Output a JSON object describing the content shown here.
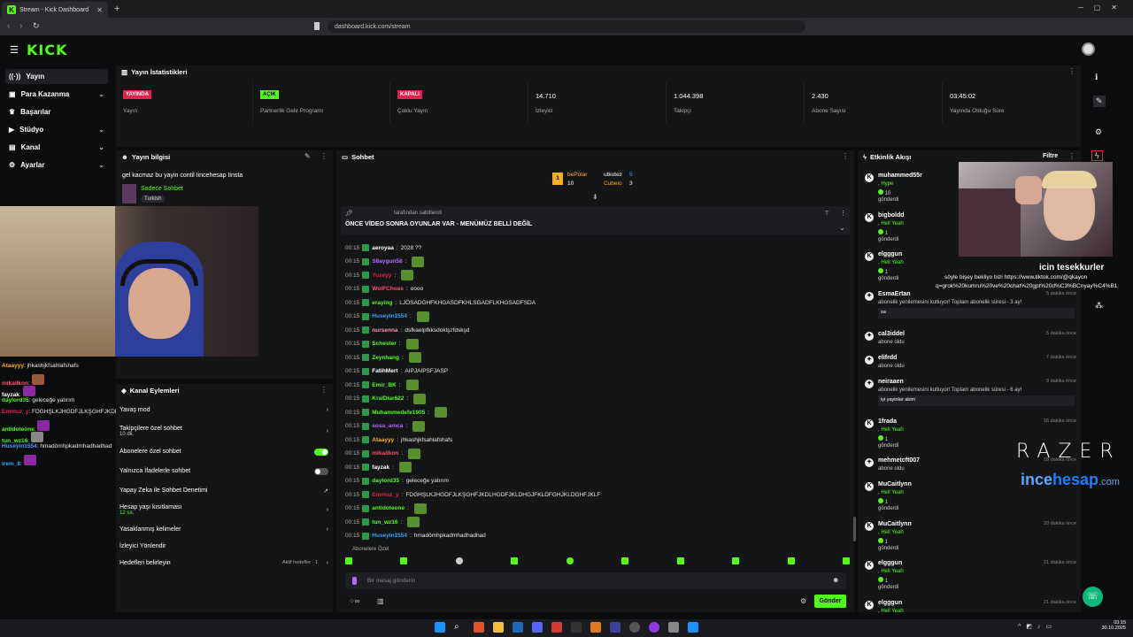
{
  "browser": {
    "tab_title": "Stream - Kick Dashboard",
    "new_tab": "+",
    "url": "dashboard.kick.com/stream"
  },
  "app": {
    "logo": "KICK"
  },
  "sidebar": {
    "items": [
      {
        "label": "Yayın",
        "icon": "broadcast-icon",
        "chevron": false,
        "active": true
      },
      {
        "label": "Para Kazanma",
        "icon": "money-icon",
        "chevron": true
      },
      {
        "label": "Başarılar",
        "icon": "trophy-icon",
        "chevron": false
      },
      {
        "label": "Stüdyo",
        "icon": "video-icon",
        "chevron": true
      },
      {
        "label": "Kanal",
        "icon": "channel-icon",
        "chevron": true
      },
      {
        "label": "Ayarlar",
        "icon": "gear-icon",
        "chevron": true
      }
    ]
  },
  "stats": {
    "title": "Yayın İstatistikleri",
    "items": [
      {
        "badge": "YAYINDA",
        "badge_color": "#e0224f",
        "label": "Yayın"
      },
      {
        "badge": "AÇIK",
        "badge_color": "#53fc18",
        "label": "Partnerlik Gelir Programı"
      },
      {
        "badge": "KAPALI",
        "badge_color": "#e0224f",
        "label": "Çoklu Yayın"
      },
      {
        "value": "14.710",
        "label": "İzleyici"
      },
      {
        "value": "1.044.398",
        "label": "Takipçi"
      },
      {
        "value": "2.430",
        "label": "Abone Sayısı"
      },
      {
        "value": "03:45:02",
        "label": "Yayında Olduğu Süre"
      }
    ]
  },
  "stream_info": {
    "title": "Yayın bilgisi",
    "stream_title": "gel kacmaz bu yayin contil Iincehesap Iinsta",
    "category": "Sadece Sohbet",
    "tag": "Turkish"
  },
  "chat": {
    "title": "Sohbet",
    "leaders": [
      {
        "rank": "1",
        "name": "bePolar",
        "count": "10"
      },
      {
        "name": "utkutez",
        "count": "5"
      },
      {
        "name": "Cubeio",
        "count": "3"
      }
    ],
    "pinned_by": "tarafından sabitlendi",
    "pinned_text": "ÖNCE VİDEO SONRA OYUNLAR VAR - MENÜMÜZ BELLİ DEĞİL",
    "messages": [
      {
        "time": "00:15",
        "user": "aeroyaa",
        "color": "#ffffff",
        "text": "2028 ??"
      },
      {
        "time": "00:15",
        "user": "S8aygun58",
        "color": "#b36bff",
        "text": "",
        "emote": true
      },
      {
        "time": "00:15",
        "user": "Yuzeyy",
        "color": "#e0224f",
        "text": "",
        "emote": true
      },
      {
        "time": "00:15",
        "user": "WolFChoas",
        "color": "#ff4d6d",
        "text": "oooo"
      },
      {
        "time": "00:15",
        "user": "eraying",
        "color": "#53fc18",
        "text": "LJÖSADGHFKHGASDFKHLSGADFLKHGSADFSDA"
      },
      {
        "time": "00:15",
        "user": "Huseyin1554",
        "color": "#3aa0ff",
        "text": "",
        "emote": true
      },
      {
        "time": "00:15",
        "user": "nursenna",
        "color": "#ff8fb1",
        "text": "dsfkaelpfkksdoklşzfdskşd"
      },
      {
        "time": "00:15",
        "user": "Schester",
        "color": "#53fc18",
        "text": "",
        "emote": true
      },
      {
        "time": "00:15",
        "user": "Zeynhang",
        "color": "#53fc18",
        "text": "",
        "emote": true
      },
      {
        "time": "00:15",
        "user": "FatihMert",
        "color": "#ffffff",
        "text": "AIPJAIPSFJASP"
      },
      {
        "time": "00:15",
        "user": "Emir_BK",
        "color": "#53fc18",
        "text": "",
        "emote": true
      },
      {
        "time": "00:15",
        "user": "KralDiar622",
        "color": "#53fc18",
        "text": "",
        "emote": true
      },
      {
        "time": "00:15",
        "user": "Muhammedefe1905",
        "color": "#53fc18",
        "text": "",
        "emote": true
      },
      {
        "time": "00:15",
        "user": "sosa_amca",
        "color": "#b36bff",
        "text": "",
        "emote": true
      },
      {
        "time": "00:15",
        "user": "Ataayyy",
        "color": "#ffb020",
        "text": "jhkashjkfsahlafshafs"
      },
      {
        "time": "00:15",
        "user": "mikailkon",
        "color": "#ff4d6d",
        "text": "",
        "emote": true
      },
      {
        "time": "00:15",
        "user": "fayzak",
        "color": "#ffffff",
        "text": "",
        "emote": true
      },
      {
        "time": "00:15",
        "user": "daylord35",
        "color": "#53fc18",
        "text": "geleceğe yatırım"
      },
      {
        "time": "00:15",
        "user": "Emmuz_y",
        "color": "#e0224f",
        "text": "FDGHŞLKJHGDFJLKŞGHFJKDLHGDFJKLDHGJFKLDFGHJKLDGHFJKLF"
      },
      {
        "time": "00:15",
        "user": "antidoteone",
        "color": "#53fc18",
        "text": "",
        "emote": true
      },
      {
        "time": "00:15",
        "user": "tun_wz16",
        "color": "#53fc18",
        "text": "",
        "emote": true
      },
      {
        "time": "00:15",
        "user": "Huseyin1554",
        "color": "#3aa0ff",
        "text": "hmadömhpkadmhadhadhad"
      }
    ],
    "subs_only": "Abonelere Özel",
    "input_placeholder": "Bir mesaj gönderin",
    "send": "Gönder"
  },
  "actions": {
    "title": "Kanal Eylemleri",
    "items": [
      {
        "label": "Yavaş mod",
        "sub": "",
        "control": "chevron"
      },
      {
        "label": "Takipçilere özel sohbet",
        "sub": "10 dk.",
        "control": "chevron"
      },
      {
        "label": "Abonelere özel sohbet",
        "sub": "",
        "control": "toggle-on"
      },
      {
        "label": "Yalnızca İfadelerle sohbet",
        "sub": "",
        "control": "toggle-off"
      },
      {
        "label": "Yapay Zeka ile Sohbet Denetimi",
        "sub": "",
        "control": "link"
      },
      {
        "label": "Hesap yaşı kısıtlaması",
        "sub": "12 sa.",
        "control": "chevron"
      },
      {
        "label": "Yasaklanmış kelimeler",
        "sub": "",
        "control": "chevron"
      },
      {
        "label": "İzleyici Yönlendir",
        "sub": "",
        "control": "none"
      },
      {
        "label": "Hedefleri belirleyin",
        "sub": "",
        "control": "chevron",
        "extra": "Aktif hedefler · 1"
      }
    ]
  },
  "events": {
    "title": "Etkinlik Akışı",
    "filter": "Filtre",
    "items": [
      {
        "name": "muhammed55r",
        "line1": ", Hype",
        "count": "10",
        "line2": "gönderdi",
        "time": ""
      },
      {
        "name": "bigboldd",
        "line1": ", Hell Yeah",
        "count": "1",
        "line2": "gönderdi",
        "time": ""
      },
      {
        "name": "elgggun",
        "line1": ", Hell Yeah",
        "count": "1",
        "line2": "gönderdi",
        "time": ""
      },
      {
        "name": "EsmaErtan",
        "line1": "abonelik yenilemesini kutluyor! Toplam abonelik süresi - 3 ay!",
        "count": "",
        "line2": "sa",
        "time": "5 dakika önce"
      },
      {
        "name": "cal3iddel",
        "line1": "abone oldu",
        "count": "",
        "line2": "",
        "time": "5 dakika önce"
      },
      {
        "name": "elifrdd",
        "line1": "abone oldu",
        "count": "",
        "line2": "",
        "time": "7 dakika önce"
      },
      {
        "name": "neiraaen",
        "line1": "abonelik yenilemesini kutluyor! Toplam abonelik süresi - 6 ay!",
        "count": "",
        "line2": "iyi yayinlar abim",
        "time": "9 dakika önce"
      },
      {
        "name": "1frada",
        "line1": ", Hell Yeah",
        "count": "1",
        "line2": "gönderdi",
        "time": "16 dakika önce"
      },
      {
        "name": "mehmetcft007",
        "line1": "abone oldu",
        "count": "",
        "line2": "",
        "time": "18 dakika önce"
      },
      {
        "name": "MuCaitlynn",
        "line1": ", Hell Yeah",
        "count": "1",
        "line2": "gönderdi",
        "time": ""
      },
      {
        "name": "MuCaitlynn",
        "line1": ", Hell Yeah",
        "count": "1",
        "line2": "gönderdi",
        "time": "20 dakika önce"
      },
      {
        "name": "elgggun",
        "line1": ", Hell Yeah",
        "count": "1",
        "line2": "gönderdi",
        "time": "21 dakika önce"
      },
      {
        "name": "elgggun",
        "line1": ", Hell Yeah",
        "count": "",
        "line2": "",
        "time": "21 dakika önce"
      }
    ]
  },
  "overlay": {
    "thanks": "icin tesekkurler",
    "tiktok": "söyle bişey bekliyo bizi https://www.tiktok.com/@qkayon",
    "tiktok2": "q=grok%20kumru%20ve%20chat%20gpt%20d%C3%BCnyay%C4%B1",
    "razer": "RAZER",
    "brand_a": "ince",
    "brand_b": "hesap",
    "brand_c": ".com"
  },
  "left_chat": [
    {
      "user": "Ataayyy",
      "color": "#ffb020",
      "text": "jhkashjkfsahlafshafs"
    },
    {
      "user": "mikailkon",
      "color": "#ff4d6d",
      "text": ""
    },
    {
      "user": "fayzak",
      "color": "#ffffff",
      "text": ""
    },
    {
      "user": "daylord35",
      "color": "#53fc18",
      "text": "geleceğe yatırım"
    },
    {
      "user": "Emmuz_y",
      "color": "#e0224f",
      "text": "FDGHŞLKJHGDFJLKŞGHFJKDLHGDFJKLDHGJFKLDFGHJKLDGHFJKLF"
    },
    {
      "user": "antidoteone",
      "color": "#53fc18",
      "text": ""
    },
    {
      "user": "tun_wz16",
      "color": "#53fc18",
      "text": ""
    },
    {
      "user": "Huseyin1554",
      "color": "#3aa0ff",
      "text": "hmadömhpkadmhadhadhad"
    },
    {
      "user": "irem_8",
      "color": "#3aa0ff",
      "text": ""
    }
  ],
  "taskbar": {
    "time": "03:15",
    "date": "30.10.2025"
  },
  "colors": {
    "accent": "#53fc18",
    "live": "#e0224f",
    "panel": "#141517",
    "bg": "#0b0c0d"
  }
}
